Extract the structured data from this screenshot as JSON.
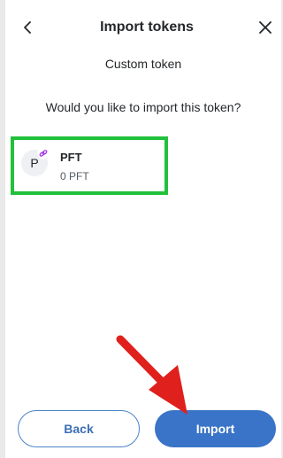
{
  "header": {
    "title": "Import tokens",
    "back_icon": "chevron-left-icon",
    "close_icon": "close-icon"
  },
  "subtitle": "Custom token",
  "prompt": "Would you like to import this token?",
  "token": {
    "avatar_letter": "P",
    "symbol": "PFT",
    "balance": "0 PFT",
    "badge_icon": "network-link-icon"
  },
  "buttons": {
    "back_label": "Back",
    "import_label": "Import"
  },
  "colors": {
    "highlight": "#21c13b",
    "primary": "#3a74c8",
    "annotation_arrow": "#e0201c"
  }
}
